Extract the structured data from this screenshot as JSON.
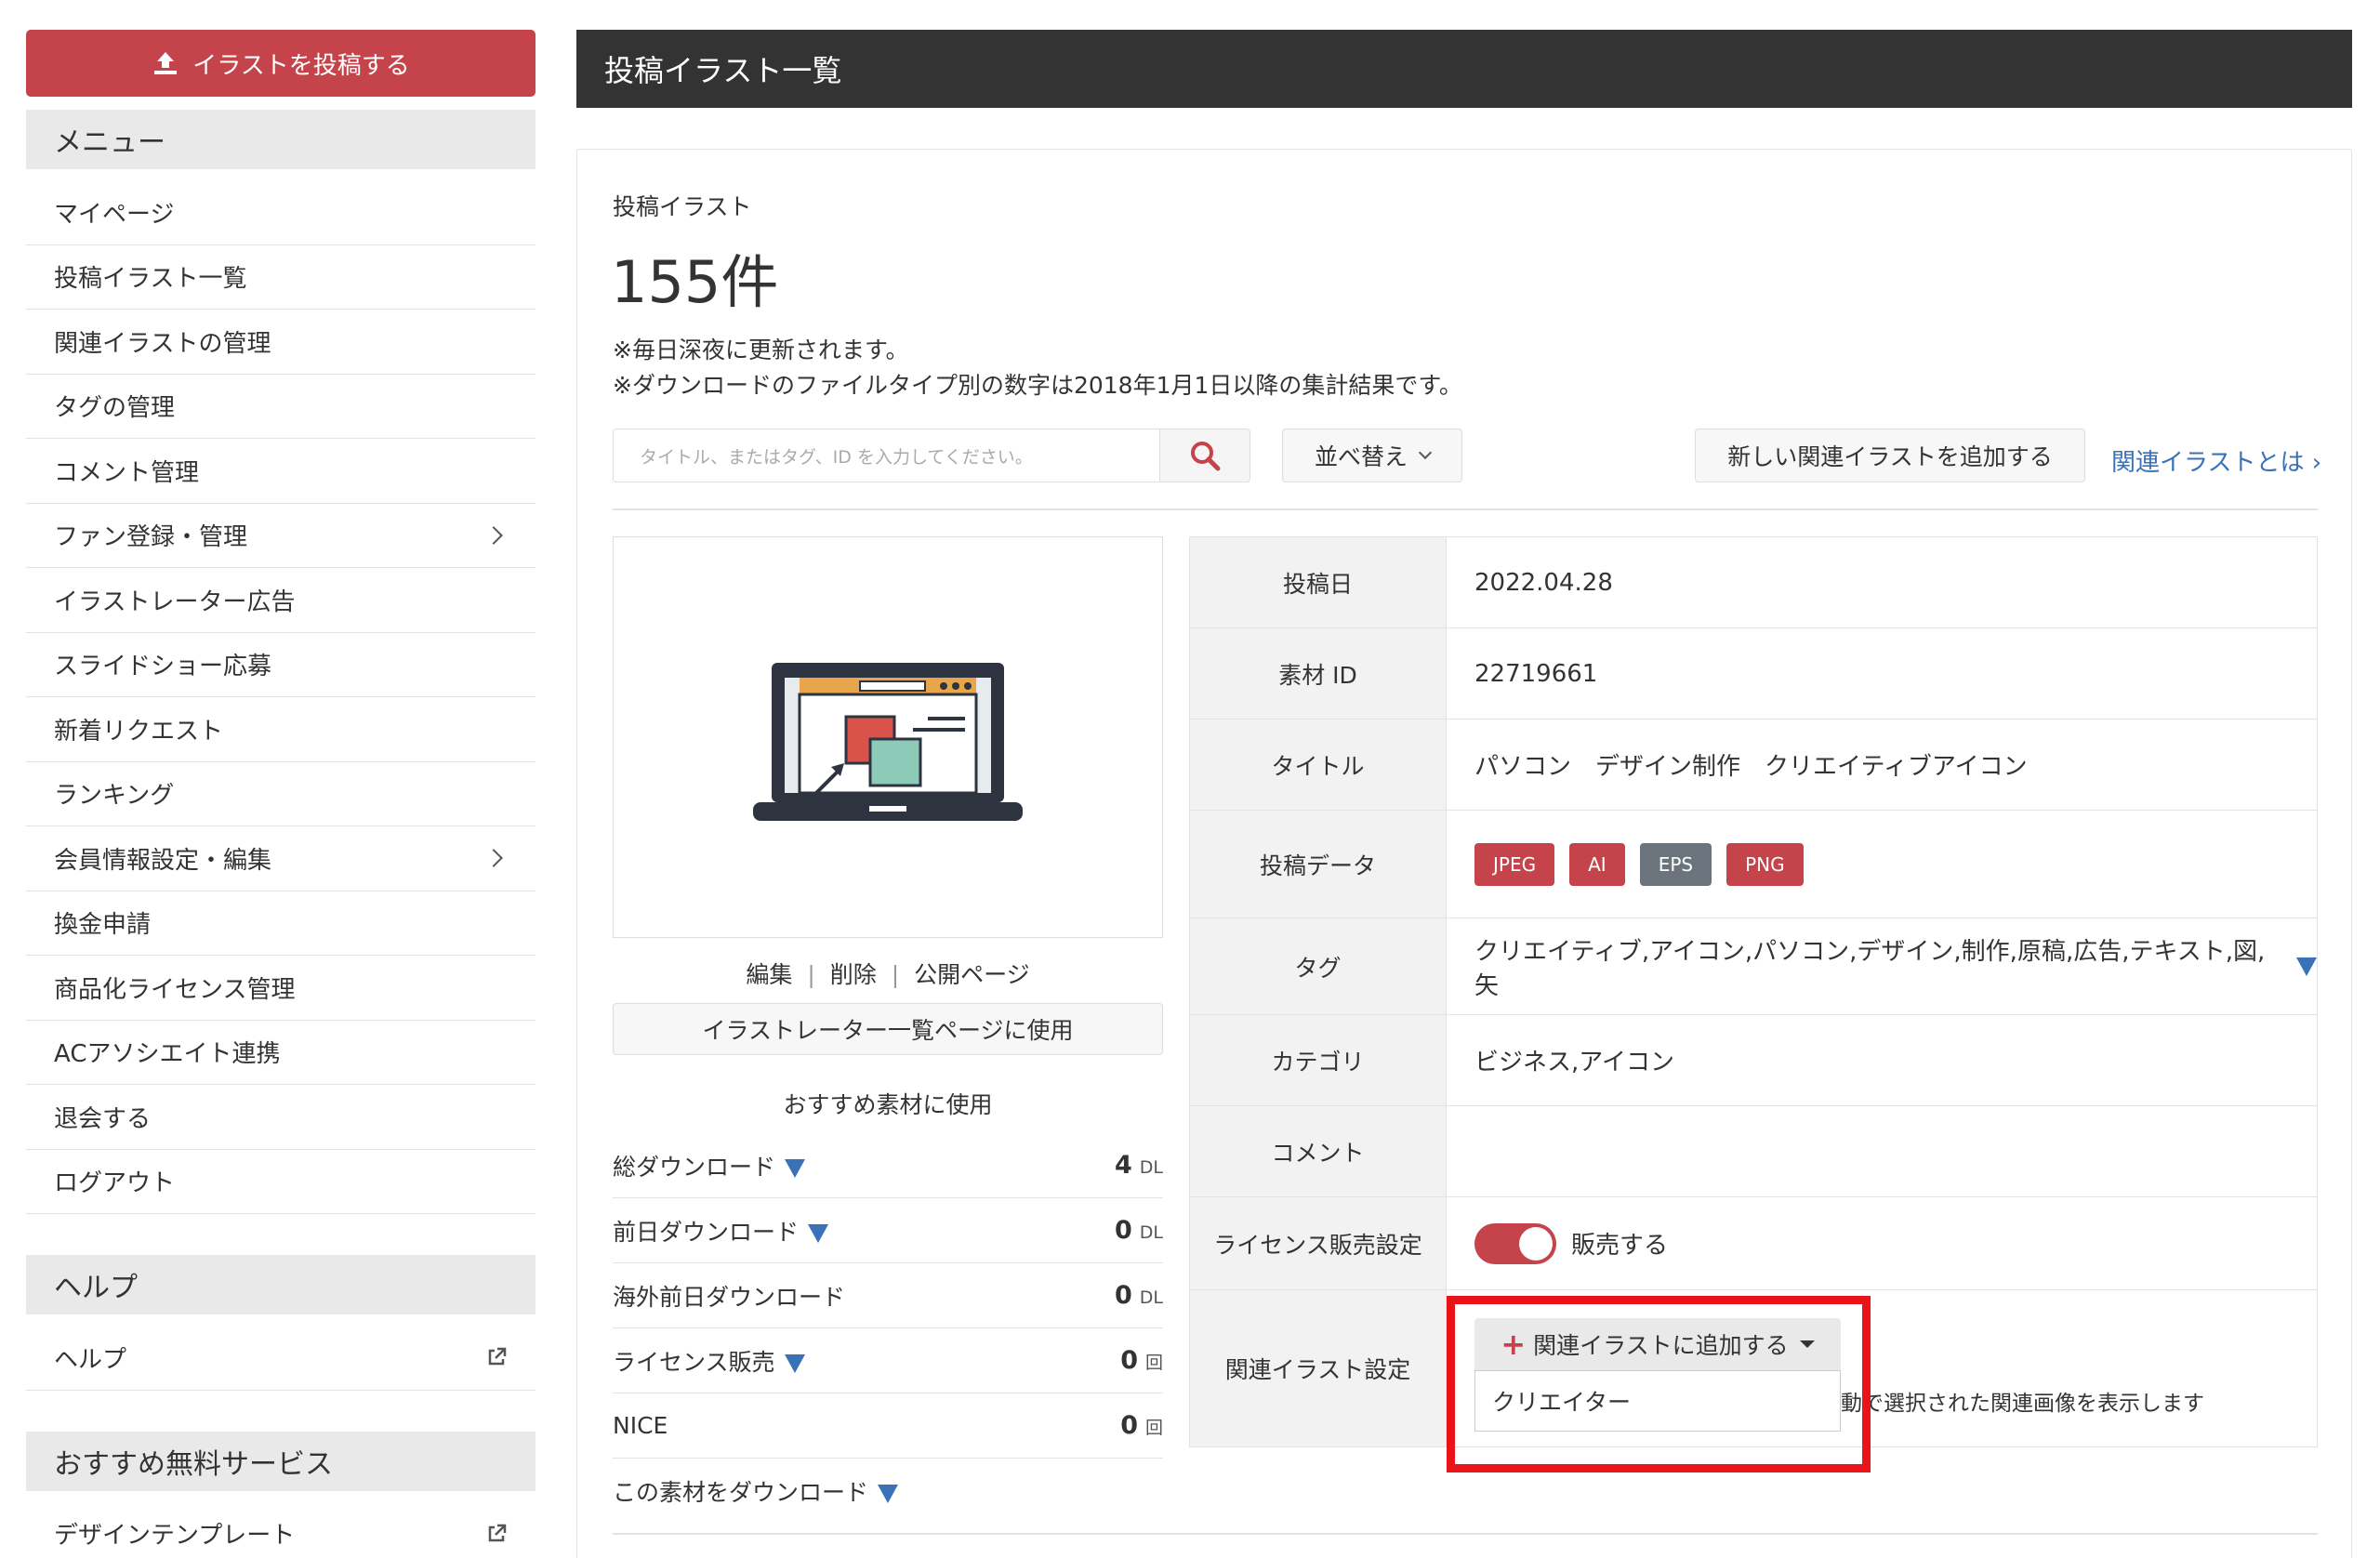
{
  "sidebar": {
    "upload_label": "イラストを投稿する",
    "menu_title": "メニュー",
    "menu_items": [
      {
        "label": "マイページ"
      },
      {
        "label": "投稿イラスト一覧"
      },
      {
        "label": "関連イラストの管理"
      },
      {
        "label": "タグの管理"
      },
      {
        "label": "コメント管理"
      },
      {
        "label": "ファン登録・管理"
      },
      {
        "label": "イラストレーター広告"
      },
      {
        "label": "スライドショー応募"
      },
      {
        "label": "新着リクエスト"
      },
      {
        "label": "ランキング"
      },
      {
        "label": "会員情報設定・編集"
      },
      {
        "label": "換金申請"
      },
      {
        "label": "商品化ライセンス管理"
      },
      {
        "label": "ACアソシエイト連携"
      },
      {
        "label": "退会する"
      },
      {
        "label": "ログアウト"
      }
    ],
    "help_title": "ヘルプ",
    "help_item": "ヘルプ",
    "services_title": "おすすめ無料サービス",
    "services_item": "デザインテンプレート"
  },
  "header": {
    "title": "投稿イラスト一覧"
  },
  "summary": {
    "label": "投稿イラスト",
    "count": "155件",
    "note1": "※毎日深夜に更新されます。",
    "note2": "※ダウンロードのファイルタイプ別の数字は2018年1月1日以降の集計結果です。"
  },
  "toolbar": {
    "search_placeholder": "タイトル、またはタグ、ID を入力してください。",
    "sort_label": "並べ替え",
    "add_related_label": "新しい関連イラストを追加する",
    "related_link": "関連イラストとは ›"
  },
  "item": {
    "actions": {
      "edit": "編集",
      "delete": "削除",
      "public": "公開ページ",
      "sep": "|"
    },
    "use_button": "イラストレーター一覧ページに使用",
    "recommend": "おすすめ素材に使用",
    "stats": [
      {
        "label": "総ダウンロード",
        "value": "4",
        "unit": "DL"
      },
      {
        "label": "前日ダウンロード",
        "value": "0",
        "unit": "DL"
      },
      {
        "label": "海外前日ダウンロード",
        "value": "0",
        "unit": "DL"
      },
      {
        "label": "ライセンス販売",
        "value": "0",
        "unit": "回"
      },
      {
        "label": "NICE",
        "value": "0",
        "unit": "回"
      },
      {
        "label": "この素材をダウンロード",
        "value": "",
        "unit": ""
      }
    ],
    "details": {
      "post_date_key": "投稿日",
      "post_date": "2022.04.28",
      "id_key": "素材 ID",
      "id": "22719661",
      "title_key": "タイトル",
      "title": "パソコン　デザイン制作　クリエイティブアイコン",
      "data_key": "投稿データ",
      "formats": [
        "JPEG",
        "AI",
        "EPS",
        "PNG"
      ],
      "tags_key": "タグ",
      "tags": "クリエイティブ,アイコン,パソコン,デザイン,制作,原稿,広告,テキスト,図,矢",
      "category_key": "カテゴリ",
      "category": "ビジネス,アイコン",
      "comment_key": "コメント",
      "comment": "",
      "license_key": "ライセンス販売設定",
      "license_label": "販売する",
      "license_on": true,
      "related_key": "関連イラスト設定",
      "related_button": "関連イラストに追加する",
      "related_option": "クリエイター",
      "related_desc": "動で選択された関連画像を表示します"
    }
  },
  "colors": {
    "accent": "#c5444c",
    "link": "#3a72b8",
    "header_bg": "#333333",
    "highlight": "#e8141a",
    "badge_gray": "#6b747c"
  }
}
